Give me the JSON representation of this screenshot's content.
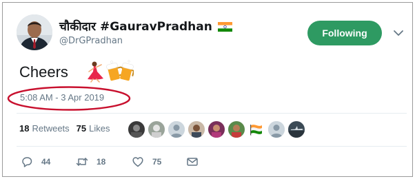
{
  "author": {
    "display_name": "चौकीदार #GauravPradhan",
    "handle": "@DrGPradhan"
  },
  "follow_button": {
    "label": "Following",
    "color": "#2e9a62"
  },
  "tweet": {
    "text": "Cheers",
    "emojis": [
      "dancer-emoji",
      "beer-mugs-emoji"
    ],
    "timestamp": "5:08 AM - 3 Apr 2019"
  },
  "stats": {
    "retweets": {
      "count": "18",
      "label": "Retweets"
    },
    "likes": {
      "count": "75",
      "label": "Likes"
    }
  },
  "likers": [
    {
      "avatar": "liker-avatar-1"
    },
    {
      "avatar": "liker-avatar-2"
    },
    {
      "avatar": "default-avatar"
    },
    {
      "avatar": "liker-avatar-4"
    },
    {
      "avatar": "liker-avatar-5"
    },
    {
      "avatar": "liker-avatar-6"
    },
    {
      "avatar": "liker-avatar-flag"
    },
    {
      "avatar": "default-avatar"
    },
    {
      "avatar": "liker-avatar-plane"
    }
  ],
  "actions": {
    "reply_count": "44",
    "retweet_count": "18",
    "like_count": "75"
  },
  "colors": {
    "annotation_ellipse": "#c8102e",
    "secondary_text": "#657786"
  }
}
